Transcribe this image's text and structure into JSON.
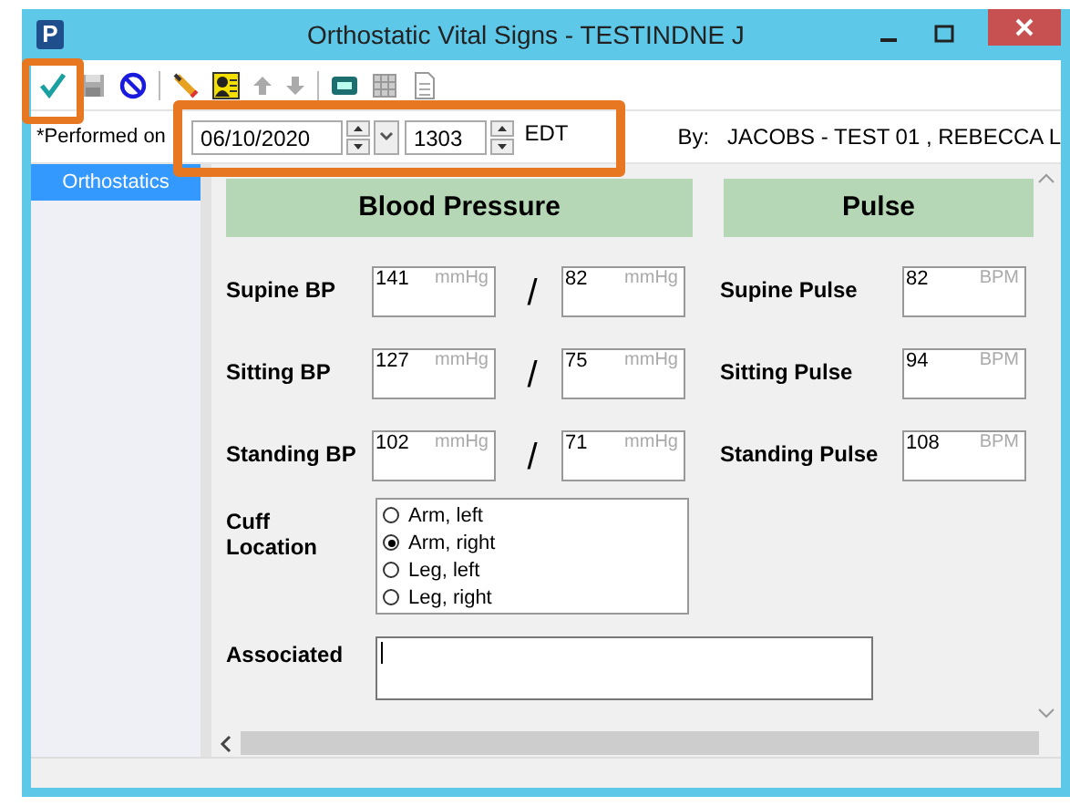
{
  "window": {
    "title": "Orthostatic Vital Signs - TESTINDNE J",
    "app_letter": "P"
  },
  "performed": {
    "label": "*Performed on",
    "date": "06/10/2020",
    "time": "1303",
    "zone": "EDT",
    "by_label": "By:",
    "by_value": "JACOBS - TEST 01 , REBECCA L"
  },
  "sidebar": {
    "items": [
      {
        "label": "Orthostatics",
        "selected": true
      }
    ]
  },
  "sections": [
    "Blood Pressure",
    "Pulse"
  ],
  "rows": [
    {
      "bp_label": "Supine BP",
      "systolic": "141",
      "systolic_unit": "mmHg",
      "diastolic": "82",
      "diastolic_unit": "mmHg",
      "separator": "/",
      "pulse_label": "Supine Pulse",
      "pulse": "82",
      "pulse_unit": "BPM"
    },
    {
      "bp_label": "Sitting BP",
      "systolic": "127",
      "systolic_unit": "mmHg",
      "diastolic": "75",
      "diastolic_unit": "mmHg",
      "separator": "/",
      "pulse_label": "Sitting Pulse",
      "pulse": "94",
      "pulse_unit": "BPM"
    },
    {
      "bp_label": "Standing BP",
      "systolic": "102",
      "systolic_unit": "mmHg",
      "diastolic": "71",
      "diastolic_unit": "mmHg",
      "separator": "/",
      "pulse_label": "Standing Pulse",
      "pulse": "108",
      "pulse_unit": "BPM"
    }
  ],
  "cuff": {
    "label": "Cuff Location",
    "options": [
      {
        "label": "Arm, left",
        "selected": false
      },
      {
        "label": "Arm, right",
        "selected": true
      },
      {
        "label": "Leg, left",
        "selected": false
      },
      {
        "label": "Leg, right",
        "selected": false
      }
    ]
  },
  "associated": {
    "label": "Associated"
  }
}
